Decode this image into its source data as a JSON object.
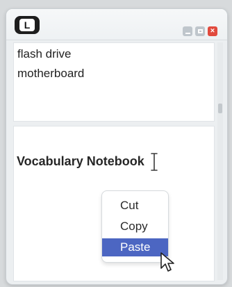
{
  "app": {
    "logo_letter": "L"
  },
  "window": {
    "controls": {
      "minimize": "minimize",
      "maximize": "maximize",
      "close": "×"
    }
  },
  "list": {
    "items": [
      "flash drive",
      "motherboard"
    ]
  },
  "editor": {
    "text": "Vocabulary Notebook"
  },
  "context_menu": {
    "items": [
      "Cut",
      "Copy",
      "Paste"
    ],
    "highlighted": "Paste",
    "highlight_color": "#4c66c2"
  },
  "colors": {
    "close_button": "#e14a3d",
    "window_background": "#eceff1"
  }
}
